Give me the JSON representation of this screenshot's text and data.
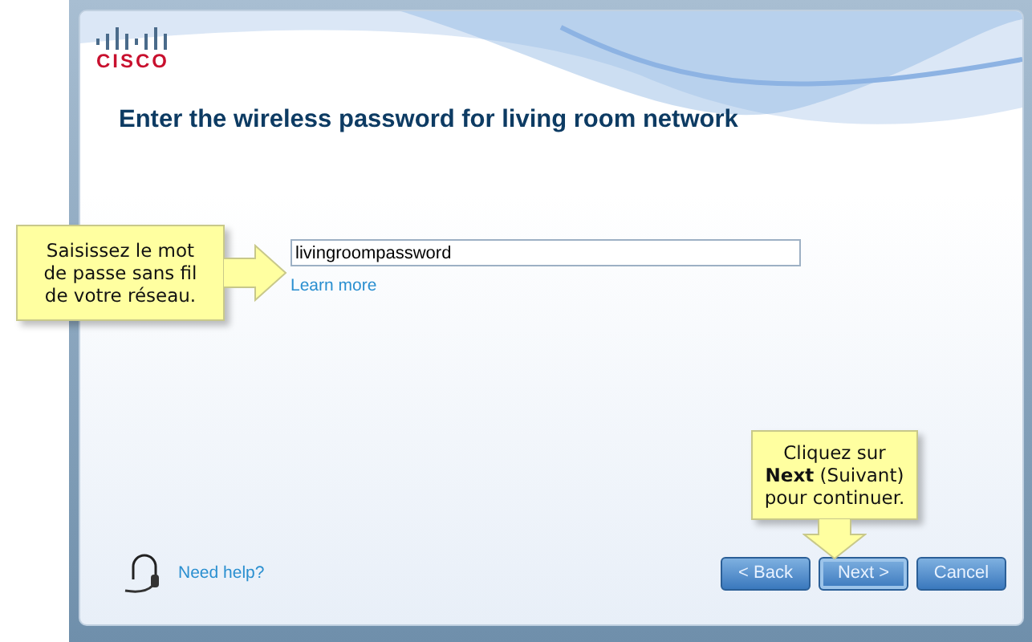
{
  "logo": {
    "text": "CISCO"
  },
  "heading": "Enter the wireless password for living room network",
  "password_field": {
    "value": "livingroompassword"
  },
  "learn_more": "Learn more",
  "help_link": "Need help?",
  "buttons": [
    {
      "label": "< Back",
      "focused": false
    },
    {
      "label": "Next >",
      "focused": true
    },
    {
      "label": "Cancel",
      "focused": false
    }
  ],
  "callouts": [
    {
      "kind": "right",
      "text": "Saisissez le mot\nde passe sans fil\nde votre réseau."
    },
    {
      "kind": "down",
      "text": "Cliquez sur\n**Next** (Suivant)\npour continuer."
    }
  ]
}
